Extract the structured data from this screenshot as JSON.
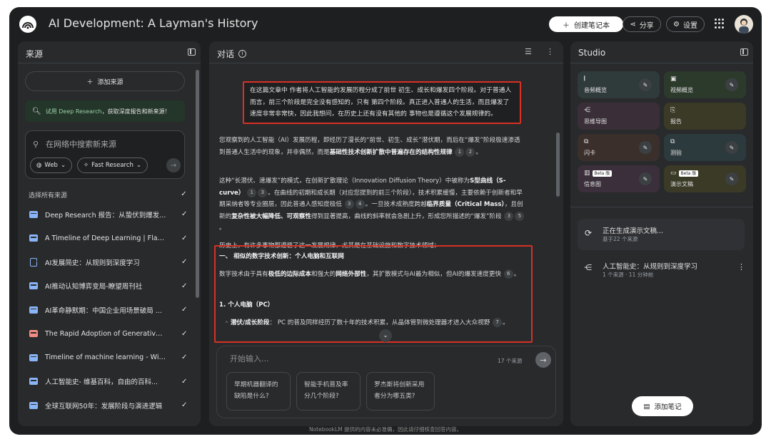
{
  "app": {
    "title": "AI Development: A Layman's History"
  },
  "header": {
    "create_label": "创建笔记本",
    "share_label": "分享",
    "settings_label": "设置"
  },
  "sources": {
    "title": "来源",
    "add_label": "添加来源",
    "promo_link": "试用 Deep Research",
    "promo_text": "，获取深度报告和新来源！",
    "search_placeholder": "在网络中搜索新来源",
    "chip_web": "Web",
    "chip_research": "Fast Research",
    "select_all": "选择所有来源",
    "items": [
      {
        "label": "Deep Research 报告：从蛰伏到爆发...",
        "type": "report"
      },
      {
        "label": "A Timeline of Deep Learning | Flagsh...",
        "type": "web"
      },
      {
        "label": "AI发展简史：从规则到深度学习",
        "type": "doc"
      },
      {
        "label": "AI推动认知博弈变局-瞭望周刊社",
        "type": "web"
      },
      {
        "label": "AI革命静默期：中国企业用场景破局 ...",
        "type": "web"
      },
      {
        "label": "The Rapid Adoption of Generative AI...",
        "type": "pdf"
      },
      {
        "label": "Timeline of machine learning - Wikip...",
        "type": "web"
      },
      {
        "label": "人工智能史- 维基百科，自由的百科...",
        "type": "web"
      },
      {
        "label": "全球互联网50年：发展阶段与演进逻辑",
        "type": "web"
      }
    ]
  },
  "chat": {
    "title": "对话",
    "user_message": "在这篇文章中 作者将人工智能的发展历程分成了前世 初生、成长和爆发四个阶段。对于普通人而言，前三个阶段是完全没有感知的，只有 第四个阶段。真正进入普通人的生活，而且爆发了速度非常非常快，因此我想问，在历史上还有没有其他的 事物也是遵循这个发展规律的。",
    "p1_a": "您观察到的人工智能（AI）发展历程，即经历了漫长的“前世、初生、成长”潜伏期，而后在“爆发”阶段极速渗透到普通人生活中的现象，并非偶然，而是",
    "p1_b": "基础性技术创新扩散中普遍存在的结构性规律",
    "p2_a": "这种“长潜伏、速爆发”的模式，在创新扩散理论（Innovation Diffusion Theory）中被称为",
    "p2_b": "S型曲线（S-curve）",
    "p2_c": "。在曲线的初期和成长期（对应您提到的前三个阶段），技术积累缓慢，主要依赖于创新者和早期采纳者等专业圈层，因此普通人感知度极低",
    "p2_d": "。一旦技术成熟度跨越",
    "p2_e": "临界质量（Critical Mass）",
    "p2_f": "，且创新的",
    "p2_g": "复杂性被大幅降低、可观察性",
    "p2_h": "得到显著提高，曲线的斜率就会急剧上升，形成您所描述的“爆发”阶段",
    "p3": "历史上，有许多事物都遵循了这一发展规律，尤其是在基础设施和数字技术领域：",
    "h1": "一、 相似的数字技术创新：个人电脑和互联网",
    "p4_a": "数字技术由于具有",
    "p4_b": "极低的边际成本",
    "p4_c": "和强大的",
    "p4_d": "网络外部性",
    "p4_e": "，其扩散模式与AI最为相似，但AI的爆发速度更快",
    "h2": "1. 个人电脑（PC）",
    "p5_a": "◦ ",
    "p5_b": "潜伏/成长阶段",
    "p5_c": "： PC 的普及同样经历了数十年的技术积累，从晶体管到微处理器才进入大众视野",
    "cites": [
      "1",
      "2",
      "1",
      "3",
      "3",
      "4",
      "3",
      "5",
      "6",
      "7"
    ],
    "composer_placeholder": "开始输入...",
    "source_count": "17 个来源",
    "suggestions": [
      "早期机器翻译的缺陷是什么?",
      "智能手机普及率分几个阶段?",
      "罗杰斯将创新采用者分为哪五类?"
    ]
  },
  "studio": {
    "title": "Studio",
    "tiles": [
      {
        "label": "音频概览",
        "color": "#2f3a3b"
      },
      {
        "label": "视频概览",
        "color": "#2c3a2c"
      },
      {
        "label": "思维导图",
        "color": "#3a2f38"
      },
      {
        "label": "报告",
        "color": "#3a3a26"
      },
      {
        "label": "闪卡",
        "color": "#3a2f2b"
      },
      {
        "label": "测验",
        "color": "#2c3a3d"
      },
      {
        "label": "信息图",
        "color": "#3a2f3a",
        "badge": "Beta 版"
      },
      {
        "label": "演示文稿",
        "color": "#3a3a26",
        "badge": "Beta 版"
      }
    ],
    "generating_title": "正在生成演示文稿...",
    "generating_sub": "基于22 个来源",
    "note_title": "人工智能史：从规则到深度学习",
    "note_sub": "1 个来源 · 11 分钟前",
    "add_note_label": "添加笔记"
  },
  "footer": {
    "disclaimer": "NotebookLM 提供的内容未必准确，因此请仔细核查回答内容。"
  }
}
